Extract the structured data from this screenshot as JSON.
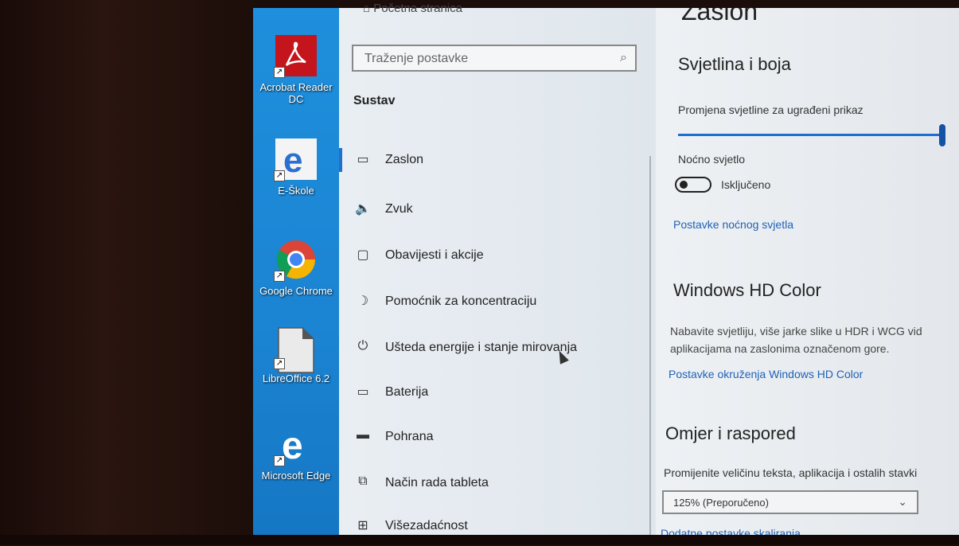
{
  "desktop": {
    "icons": [
      {
        "label": "Acrobat Reader DC",
        "icon": "acrobat-icon",
        "color": "#c4151c"
      },
      {
        "label": "E-Škole",
        "icon": "edge-legacy-icon",
        "color": "#2b6fd0"
      },
      {
        "label": "Google Chrome",
        "icon": "chrome-icon",
        "color": "#db4437"
      },
      {
        "label": "LibreOffice 6.2",
        "icon": "libreoffice-icon",
        "color": "#e8e8e8"
      },
      {
        "label": "Microsoft Edge",
        "icon": "edge-icon",
        "color": "#1f6fd6"
      }
    ]
  },
  "nav": {
    "top_item": "Početna stranica",
    "search_placeholder": "Traženje postavke",
    "section": "Sustav",
    "items": [
      {
        "label": "Zaslon",
        "icon": "display-icon",
        "active": true
      },
      {
        "label": "Zvuk",
        "icon": "speaker-icon"
      },
      {
        "label": "Obavijesti i akcije",
        "icon": "notification-icon"
      },
      {
        "label": "Pomoćnik za koncentraciju",
        "icon": "moon-icon"
      },
      {
        "label": "Ušteda energije i stanje mirovanja",
        "icon": "power-icon"
      },
      {
        "label": "Baterija",
        "icon": "battery-icon"
      },
      {
        "label": "Pohrana",
        "icon": "storage-icon"
      },
      {
        "label": "Način rada tableta",
        "icon": "tablet-icon"
      },
      {
        "label": "Višezadaćnost",
        "icon": "multitask-icon"
      }
    ]
  },
  "content": {
    "title": "Zaslon",
    "brightness_heading": "Svjetlina i boja",
    "brightness_label": "Promjena svjetline za ugrađeni prikaz",
    "night_light_label": "Noćno svjetlo",
    "night_light_state": "Isključeno",
    "night_light_link": "Postavke noćnog svjetla",
    "hdr_heading": "Windows HD Color",
    "hdr_text_1": "Nabavite svjetliju, više jarke slike u HDR i WCG vid",
    "hdr_text_2": "aplikacijama na zaslonima označenom gore.",
    "hdr_link": "Postavke okruženja Windows HD Color",
    "scale_heading": "Omjer i raspored",
    "scale_label": "Promijenite veličinu teksta, aplikacija i ostalih stavki",
    "scale_value": "125% (Preporučeno)",
    "scale_link": "Dodatne postavke skaliranja"
  },
  "colors": {
    "accent": "#1e6fd0",
    "link": "#1f62b8"
  }
}
